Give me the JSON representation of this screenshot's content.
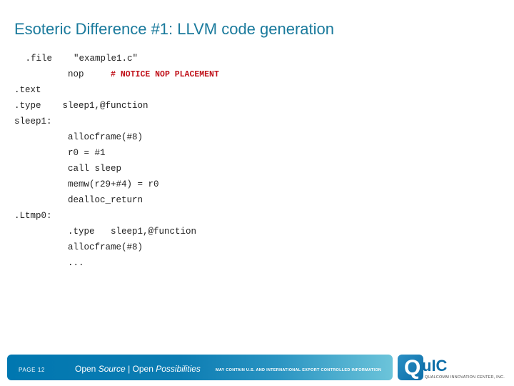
{
  "slide": {
    "title": "Esoteric Difference #1: LLVM code generation",
    "code_lines": [
      {
        "text": " .file    \"example1.c\""
      },
      {
        "text": "          nop     ",
        "note": "# NOTICE NOP PLACEMENT"
      },
      {
        "text": ".text"
      },
      {
        "text": ".type    sleep1,@function"
      },
      {
        "text": "sleep1:"
      },
      {
        "text": "          allocframe(#8)"
      },
      {
        "text": "          r0 = #1"
      },
      {
        "text": "          call sleep"
      },
      {
        "text": "          memw(r29+#4) = r0"
      },
      {
        "text": "          dealloc_return"
      },
      {
        "text": ".Ltmp0:"
      },
      {
        "text": "          .type   sleep1,@function"
      },
      {
        "text": "          allocframe(#8)"
      },
      {
        "text": "          ..."
      }
    ]
  },
  "footer": {
    "page_label": "PAGE 12",
    "tagline_open1": "Open ",
    "tagline_source": "Source",
    "tagline_sep": " | Open ",
    "tagline_possibilities": "Possibilities",
    "export_notice": "MAY CONTAIN U.S. AND INTERNATIONAL EXPORT CONTROLLED INFORMATION",
    "logo_q": "Q",
    "logo_text": "uIC",
    "logo_subtitle": "QUALCOMM INNOVATION CENTER, INC."
  },
  "colors": {
    "title": "#1a7a9c",
    "note": "#c0111a",
    "footer_bar": "#0077b0"
  }
}
